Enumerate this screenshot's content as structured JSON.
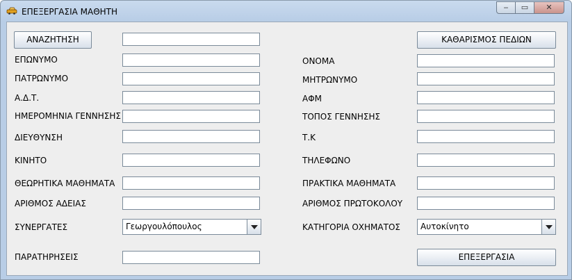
{
  "window": {
    "title": "ΕΠΕΞΕΡΓΑΣΙΑ ΜΑΘΗΤΗ",
    "controls": {
      "minimize": "‒",
      "maximize": "▭",
      "close": "✕"
    }
  },
  "buttons": {
    "search": "ΑΝΑΖΗΤΗΣΗ",
    "clear": "ΚΑΘΑΡΙΣΜΟΣ ΠΕΔΙΩΝ",
    "edit": "ΕΠΕΞΕΡΓΑΣΙΑ"
  },
  "search_field": {
    "value": ""
  },
  "left_fields": [
    {
      "label": "ΕΠΩΝΥΜΟ",
      "value": ""
    },
    {
      "label": "ΠΑΤΡΩΝΥΜΟ",
      "value": ""
    },
    {
      "label": "Α.Δ.Τ.",
      "value": ""
    },
    {
      "label": "ΗΜΕΡΟΜΗΝΙΑ ΓΕΝΝΗΣΗΣ",
      "value": ""
    },
    {
      "label": "ΔΙΕΥΘΥΝΣΗ",
      "value": ""
    },
    {
      "label": "ΚΙΝΗΤΟ",
      "value": ""
    },
    {
      "label": "ΘΕΩΡΗΤΙΚΑ ΜΑΘΗΜΑΤΑ",
      "value": ""
    },
    {
      "label": "ΑΡΙΘΜΟΣ ΑΔΕΙΑΣ",
      "value": ""
    }
  ],
  "right_fields": [
    {
      "label": "ΟΝΟΜΑ",
      "value": ""
    },
    {
      "label": "ΜΗΤΡΩΝΥΜΟ",
      "value": ""
    },
    {
      "label": "ΑΦΜ",
      "value": ""
    },
    {
      "label": "ΤΟΠΟΣ ΓΕΝΝΗΣΗΣ",
      "value": ""
    },
    {
      "label": "Τ.Κ",
      "value": ""
    },
    {
      "label": "ΤΗΛΕΦΩΝΟ",
      "value": ""
    },
    {
      "label": "ΠΡΑΚΤΙΚΑ ΜΑΘΗΜΑΤΑ",
      "value": ""
    },
    {
      "label": "ΑΡΙΘΜΟΣ ΠΡΩΤΟΚΟΛΟΥ",
      "value": ""
    }
  ],
  "partners": {
    "label": "ΣΥΝΕΡΓΑΤΕΣ",
    "selected": "Γεωργουλόπουλος"
  },
  "vehicle_category": {
    "label": "ΚΑΤΗΓΟΡΙΑ ΟΧΗΜΑΤΟΣ",
    "selected": "Αυτοκίνητο"
  },
  "notes": {
    "label": "ΠΑΡΑΤΗΡΗΣΕΙΣ",
    "value": ""
  }
}
